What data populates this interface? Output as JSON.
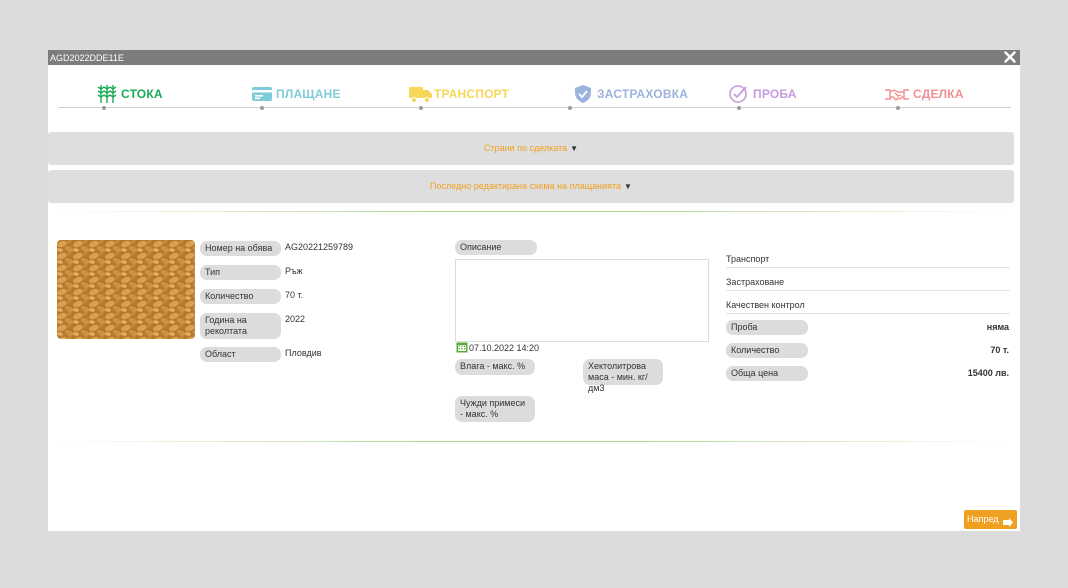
{
  "window": {
    "title": "AGD2022DDE11E"
  },
  "steps": [
    {
      "label": "СТОКА",
      "color": "#1aaa55",
      "icon": "wheat-icon"
    },
    {
      "label": "ПЛАЩАНЕ",
      "color": "#7fcbd8",
      "icon": "credit-card-icon"
    },
    {
      "label": "ТРАНСПОРТ",
      "color": "#f7d75a",
      "icon": "truck-icon"
    },
    {
      "label": "ЗАСТРАХОВКА",
      "color": "#9cb3dd",
      "icon": "shield-check-icon"
    },
    {
      "label": "ПРОБА",
      "color": "#c79be0",
      "icon": "check-circle-icon"
    },
    {
      "label": "СДЕЛКА",
      "color": "#f28f8f",
      "icon": "handshake-icon"
    }
  ],
  "sections": {
    "parties": "Страни по сделката",
    "payment_scheme": "Последно редактирана схема на плащанията"
  },
  "product": {
    "image_icon": "wheat-grain-photo",
    "fields": [
      {
        "label": "Номер на обява",
        "value": "AG20221259789"
      },
      {
        "label": "Тип",
        "value": "Ръж"
      },
      {
        "label": "Количество",
        "value": "70 т."
      },
      {
        "label": "Година на реколтата",
        "value": "2022"
      },
      {
        "label": "Област",
        "value": "Пловдив"
      }
    ]
  },
  "description": {
    "label": "Описание",
    "date": "07.10.2022 14:20",
    "moisture_label": "Влага - макс. %",
    "hectoliter_label": "Хектолитрова маса - мин. кг/дм3",
    "impurities_label": "Чужди примеси - макс. %"
  },
  "summary": {
    "transport": "Транспорт",
    "insurance": "Застраховане",
    "quality": "Качествен контрол",
    "rows": [
      {
        "label": "Проба",
        "value": "няма"
      },
      {
        "label": "Количество",
        "value": "70 т."
      },
      {
        "label": "Обща цена",
        "value": "15400 лв."
      }
    ]
  },
  "footer": {
    "next_label": "Напред"
  }
}
